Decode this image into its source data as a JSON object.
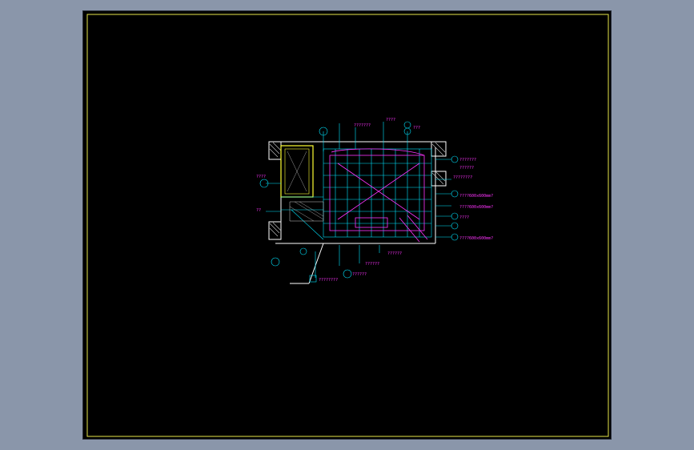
{
  "colors": {
    "background": "#8a96aa",
    "canvas": "#000000",
    "frame": "#e6e64a",
    "wall": "#ffffff",
    "cyan": "#00e5ff",
    "magenta": "#ff33ff",
    "yellow": "#ffff33",
    "hatch": "#c8c8c8"
  },
  "labels": {
    "top_1": "???????",
    "top_2": "????",
    "top_3": "???",
    "right_1": "???????",
    "right_2": "??????",
    "right_3": "????????",
    "right_4": "????600x600mm?",
    "right_5": "????600x600mm?",
    "right_6": "????",
    "right_7": "????600x600mm?",
    "bottom_1": "??????",
    "bottom_2": "??????",
    "bottom_3": "????????",
    "bottom_4": "??????",
    "left_1": "????",
    "left_2": "??"
  }
}
